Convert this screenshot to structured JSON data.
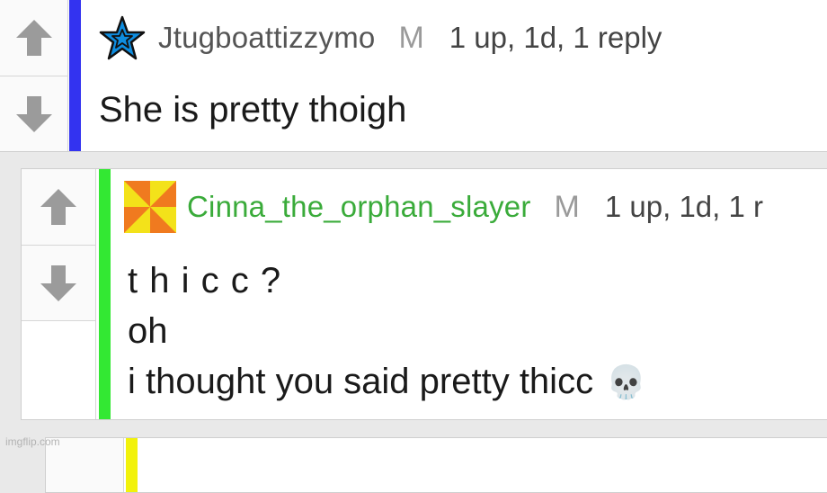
{
  "colors": {
    "comment1_bar": "#3333f0",
    "comment2_bar": "#33e833",
    "comment3_bar": "#f2f20a",
    "comment2_username": "#3aab3a",
    "comment1_username": "#555555"
  },
  "comment1": {
    "username": "Jtugboattizzymo",
    "gender": "M",
    "meta": "1 up, 1d, 1 reply",
    "text": "She is pretty thoigh",
    "avatar_icon": "blue-star-icon"
  },
  "comment2": {
    "username": "Cinna_the_orphan_slayer",
    "gender": "M",
    "meta": "1 up, 1d, 1 r",
    "lines": [
      "t h i c c ?",
      "oh",
      "i thought you said pretty thicc"
    ],
    "emoji": "💀",
    "avatar_icon": "pinwheel-avatar-icon"
  },
  "watermark": "imgflip.com"
}
